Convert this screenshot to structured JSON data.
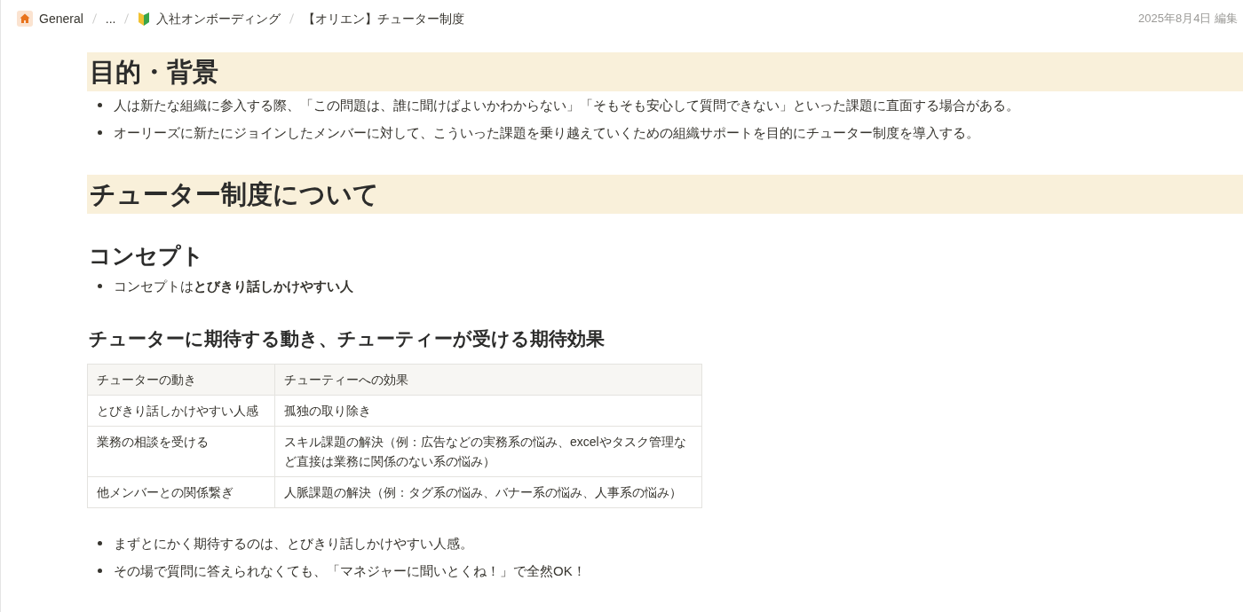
{
  "breadcrumb": [
    {
      "kind": "home",
      "label": "General"
    },
    {
      "kind": "plain",
      "label": "..."
    },
    {
      "kind": "beginner",
      "label": "入社オンボーディング"
    },
    {
      "kind": "plain",
      "label": "【オリエン】チューター制度"
    }
  ],
  "edited": "2025年8月4日 編集",
  "blocks": [
    {
      "kind": "h1",
      "text": "目的・背景"
    },
    {
      "kind": "bullet",
      "text": "人は新たな組織に参入する際、「この問題は、誰に聞けばよいかわからない」「そもそも安心して質問できない」といった課題に直面する場合がある。"
    },
    {
      "kind": "bullet",
      "text": "オーリーズに新たにジョインしたメンバーに対して、こういった課題を乗り越えていくための組織サポートを目的にチューター制度を導入する。"
    },
    {
      "kind": "h1",
      "text": "チューター制度について"
    },
    {
      "kind": "h2",
      "text": "コンセプト"
    },
    {
      "kind": "bullet",
      "text": "コンセプトは**とびきり話しかけやすい人**"
    },
    {
      "kind": "h3",
      "text": "チューターに期待する動き、チューティーが受ける期待効果"
    },
    {
      "kind": "table",
      "columns": [
        "チューターの動き",
        "チューティーへの効果"
      ],
      "rows": [
        [
          "とびきり話しかけやすい人感",
          "孤独の取り除き"
        ],
        [
          "業務の相談を受ける",
          "スキル課題の解決（例：広告などの実務系の悩み、excelやタスク管理など直接は業務に関係のない系の悩み）"
        ],
        [
          "他メンバーとの関係繋ぎ",
          "人脈課題の解決（例：タグ系の悩み、バナー系の悩み、人事系の悩み）"
        ]
      ]
    },
    {
      "kind": "bullet",
      "text": "まずとにかく期待するのは、とびきり話しかけやすい人感。"
    },
    {
      "kind": "bullet",
      "text": "その場で質問に答えられなくても、「マネジャーに聞いとくね！」で全然OK！"
    }
  ]
}
